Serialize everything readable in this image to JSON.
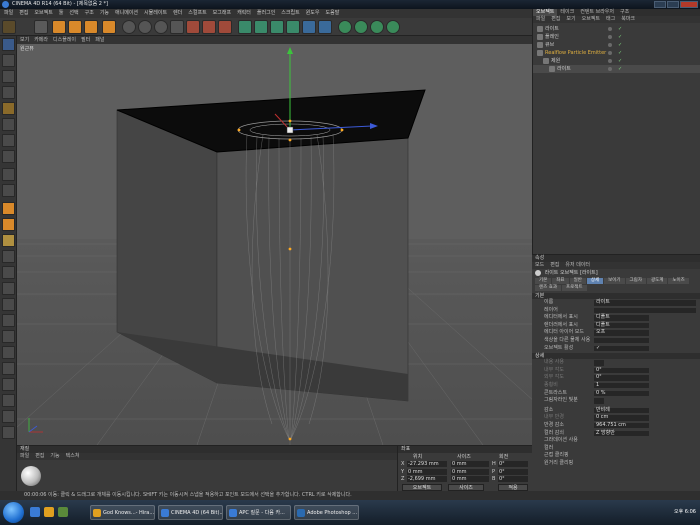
{
  "window": {
    "title": "CINEMA 4D R14 (64 Bit) - [제목없음 2 *]"
  },
  "menubar": [
    "파일",
    "편집",
    "오브젝트",
    "툴",
    "선택",
    "구조",
    "기능",
    "애니메이션",
    "시뮬레이트",
    "렌더",
    "스컬프트",
    "모그래프",
    "캐릭터",
    "플러그인",
    "스크립트",
    "윈도우",
    "도움말"
  ],
  "viewport": {
    "menu": [
      "보기",
      "카메라",
      "디스플레이",
      "필터",
      "패널"
    ],
    "label": "원근뷰"
  },
  "object_manager": {
    "tabs": [
      "오브젝트",
      "테이크",
      "컨텐트 브라우저",
      "구조"
    ],
    "submenu": [
      "파일",
      "편집",
      "보기",
      "오브젝트",
      "태그",
      "북마크"
    ],
    "objects": [
      {
        "name": "라이트",
        "indent": 0
      },
      {
        "name": "플레인",
        "indent": 0
      },
      {
        "name": "큐브",
        "indent": 0
      },
      {
        "name": "Realflow Particle Emitter",
        "indent": 0,
        "highlight": true
      },
      {
        "name": "제원",
        "indent": 1
      },
      {
        "name": "라이트",
        "indent": 2,
        "selected": true
      }
    ]
  },
  "attributes": {
    "header": "속성",
    "menu": [
      "모드",
      "편집",
      "유저 데이터"
    ],
    "title": "라이트 오브젝트 [라이트]",
    "tabs": [
      "기본",
      "좌표",
      "일반",
      "상세",
      "보이기",
      "그림자",
      "광도계",
      "노이즈",
      "렌즈 효과",
      "프로젝트"
    ],
    "active_tab": "상세",
    "basic_section": "기본",
    "basic": [
      {
        "label": "이름",
        "value": "라이트"
      },
      {
        "label": "레이어",
        "value": ""
      },
      {
        "label": "에디터에서 표시",
        "value": "디폴트"
      },
      {
        "label": "렌더러에서 표시",
        "value": "디폴트"
      },
      {
        "label": "에디터 아이어 모드",
        "value": "오프"
      },
      {
        "label": "색상을 다른 물체 사용",
        "value": ""
      },
      {
        "label": "오브젝트 활성",
        "value": "✓"
      }
    ],
    "detail_section": "상세",
    "detail": [
      {
        "label": "내용 사용",
        "value": "",
        "dim": true
      },
      {
        "label": "내부 각도",
        "value": "0°",
        "dim": true
      },
      {
        "label": "외부 각도",
        "value": "0°",
        "dim": true
      },
      {
        "label": "종횡비",
        "value": "1",
        "dim": true
      },
      {
        "label": "콘트라스트",
        "value": "0 %"
      },
      {
        "label": "그림자라인 빛분",
        "value": ""
      }
    ],
    "falloff_rows": [
      {
        "label": "감소",
        "value": "반비례"
      },
      {
        "label": "내부 반경",
        "value": "0 cm",
        "dim": true
      },
      {
        "label": "반경 감소",
        "value": "964.751 cm"
      },
      {
        "label": "컬러 감쇠",
        "value": "Z 방향만"
      }
    ],
    "extra_rows": [
      "그라데이션 사용",
      "컬러",
      "근접 클리핑",
      "원거리 클리핑"
    ]
  },
  "material_panel": {
    "title": "재질",
    "menu": [
      "파일",
      "편집",
      "기능",
      "텍스쳐"
    ]
  },
  "coord_panel": {
    "title": "좌표",
    "cols": [
      "위치",
      "사이즈",
      "회전"
    ],
    "rows": [
      {
        "axis": "X",
        "pos": "-27.293 mm",
        "size": "0 mm",
        "rot_label": "H",
        "rot": "0°"
      },
      {
        "axis": "Y",
        "pos": "0 mm",
        "size": "0 mm",
        "rot_label": "P",
        "rot": "0°"
      },
      {
        "axis": "Z",
        "pos": "-2,699 mm",
        "size": "0 mm",
        "rot_label": "B",
        "rot": "0°"
      }
    ],
    "mode_select": "오브젝트",
    "size_select": "사이즈",
    "apply_button": "적용"
  },
  "status": {
    "text": "00:00:06  이동: 클릭 & 드래그로 개체를 이동시킵니다. SHIFT 키는 이동시켜 스냅을 적용하고 포인트 모드에서 선택을 추가합니다. CTRL 키로 삭제합니다."
  },
  "taskbar": {
    "tasks": [
      {
        "label": "God Knows...- Hira...",
        "color": "#e0a020"
      },
      {
        "label": "CINEMA 4D (64 Bit)...",
        "color": "#3a7bd5"
      },
      {
        "label": "APC 질문 - 다음 카...",
        "color": "#3a7bd5"
      },
      {
        "label": "Adobe Photoshop ...",
        "color": "#2a6ab0"
      }
    ],
    "clock": "오후 6:06"
  },
  "colors": {
    "accent": "#5f82b0",
    "viewport_bg": "#5e5e5e",
    "highlight_obj": "#e0b040"
  }
}
